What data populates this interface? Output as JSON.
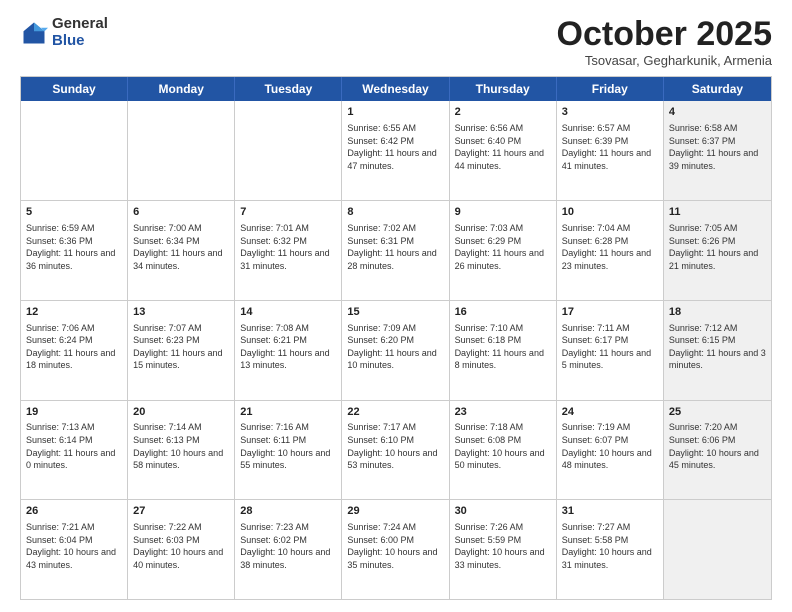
{
  "logo": {
    "general": "General",
    "blue": "Blue"
  },
  "title": "October 2025",
  "location": "Tsovasar, Gegharkunik, Armenia",
  "days_of_week": [
    "Sunday",
    "Monday",
    "Tuesday",
    "Wednesday",
    "Thursday",
    "Friday",
    "Saturday"
  ],
  "weeks": [
    [
      {
        "day": "",
        "sunrise": "",
        "sunset": "",
        "daylight": "",
        "shaded": false
      },
      {
        "day": "",
        "sunrise": "",
        "sunset": "",
        "daylight": "",
        "shaded": false
      },
      {
        "day": "",
        "sunrise": "",
        "sunset": "",
        "daylight": "",
        "shaded": false
      },
      {
        "day": "1",
        "sunrise": "Sunrise: 6:55 AM",
        "sunset": "Sunset: 6:42 PM",
        "daylight": "Daylight: 11 hours and 47 minutes.",
        "shaded": false
      },
      {
        "day": "2",
        "sunrise": "Sunrise: 6:56 AM",
        "sunset": "Sunset: 6:40 PM",
        "daylight": "Daylight: 11 hours and 44 minutes.",
        "shaded": false
      },
      {
        "day": "3",
        "sunrise": "Sunrise: 6:57 AM",
        "sunset": "Sunset: 6:39 PM",
        "daylight": "Daylight: 11 hours and 41 minutes.",
        "shaded": false
      },
      {
        "day": "4",
        "sunrise": "Sunrise: 6:58 AM",
        "sunset": "Sunset: 6:37 PM",
        "daylight": "Daylight: 11 hours and 39 minutes.",
        "shaded": true
      }
    ],
    [
      {
        "day": "5",
        "sunrise": "Sunrise: 6:59 AM",
        "sunset": "Sunset: 6:36 PM",
        "daylight": "Daylight: 11 hours and 36 minutes.",
        "shaded": false
      },
      {
        "day": "6",
        "sunrise": "Sunrise: 7:00 AM",
        "sunset": "Sunset: 6:34 PM",
        "daylight": "Daylight: 11 hours and 34 minutes.",
        "shaded": false
      },
      {
        "day": "7",
        "sunrise": "Sunrise: 7:01 AM",
        "sunset": "Sunset: 6:32 PM",
        "daylight": "Daylight: 11 hours and 31 minutes.",
        "shaded": false
      },
      {
        "day": "8",
        "sunrise": "Sunrise: 7:02 AM",
        "sunset": "Sunset: 6:31 PM",
        "daylight": "Daylight: 11 hours and 28 minutes.",
        "shaded": false
      },
      {
        "day": "9",
        "sunrise": "Sunrise: 7:03 AM",
        "sunset": "Sunset: 6:29 PM",
        "daylight": "Daylight: 11 hours and 26 minutes.",
        "shaded": false
      },
      {
        "day": "10",
        "sunrise": "Sunrise: 7:04 AM",
        "sunset": "Sunset: 6:28 PM",
        "daylight": "Daylight: 11 hours and 23 minutes.",
        "shaded": false
      },
      {
        "day": "11",
        "sunrise": "Sunrise: 7:05 AM",
        "sunset": "Sunset: 6:26 PM",
        "daylight": "Daylight: 11 hours and 21 minutes.",
        "shaded": true
      }
    ],
    [
      {
        "day": "12",
        "sunrise": "Sunrise: 7:06 AM",
        "sunset": "Sunset: 6:24 PM",
        "daylight": "Daylight: 11 hours and 18 minutes.",
        "shaded": false
      },
      {
        "day": "13",
        "sunrise": "Sunrise: 7:07 AM",
        "sunset": "Sunset: 6:23 PM",
        "daylight": "Daylight: 11 hours and 15 minutes.",
        "shaded": false
      },
      {
        "day": "14",
        "sunrise": "Sunrise: 7:08 AM",
        "sunset": "Sunset: 6:21 PM",
        "daylight": "Daylight: 11 hours and 13 minutes.",
        "shaded": false
      },
      {
        "day": "15",
        "sunrise": "Sunrise: 7:09 AM",
        "sunset": "Sunset: 6:20 PM",
        "daylight": "Daylight: 11 hours and 10 minutes.",
        "shaded": false
      },
      {
        "day": "16",
        "sunrise": "Sunrise: 7:10 AM",
        "sunset": "Sunset: 6:18 PM",
        "daylight": "Daylight: 11 hours and 8 minutes.",
        "shaded": false
      },
      {
        "day": "17",
        "sunrise": "Sunrise: 7:11 AM",
        "sunset": "Sunset: 6:17 PM",
        "daylight": "Daylight: 11 hours and 5 minutes.",
        "shaded": false
      },
      {
        "day": "18",
        "sunrise": "Sunrise: 7:12 AM",
        "sunset": "Sunset: 6:15 PM",
        "daylight": "Daylight: 11 hours and 3 minutes.",
        "shaded": true
      }
    ],
    [
      {
        "day": "19",
        "sunrise": "Sunrise: 7:13 AM",
        "sunset": "Sunset: 6:14 PM",
        "daylight": "Daylight: 11 hours and 0 minutes.",
        "shaded": false
      },
      {
        "day": "20",
        "sunrise": "Sunrise: 7:14 AM",
        "sunset": "Sunset: 6:13 PM",
        "daylight": "Daylight: 10 hours and 58 minutes.",
        "shaded": false
      },
      {
        "day": "21",
        "sunrise": "Sunrise: 7:16 AM",
        "sunset": "Sunset: 6:11 PM",
        "daylight": "Daylight: 10 hours and 55 minutes.",
        "shaded": false
      },
      {
        "day": "22",
        "sunrise": "Sunrise: 7:17 AM",
        "sunset": "Sunset: 6:10 PM",
        "daylight": "Daylight: 10 hours and 53 minutes.",
        "shaded": false
      },
      {
        "day": "23",
        "sunrise": "Sunrise: 7:18 AM",
        "sunset": "Sunset: 6:08 PM",
        "daylight": "Daylight: 10 hours and 50 minutes.",
        "shaded": false
      },
      {
        "day": "24",
        "sunrise": "Sunrise: 7:19 AM",
        "sunset": "Sunset: 6:07 PM",
        "daylight": "Daylight: 10 hours and 48 minutes.",
        "shaded": false
      },
      {
        "day": "25",
        "sunrise": "Sunrise: 7:20 AM",
        "sunset": "Sunset: 6:06 PM",
        "daylight": "Daylight: 10 hours and 45 minutes.",
        "shaded": true
      }
    ],
    [
      {
        "day": "26",
        "sunrise": "Sunrise: 7:21 AM",
        "sunset": "Sunset: 6:04 PM",
        "daylight": "Daylight: 10 hours and 43 minutes.",
        "shaded": false
      },
      {
        "day": "27",
        "sunrise": "Sunrise: 7:22 AM",
        "sunset": "Sunset: 6:03 PM",
        "daylight": "Daylight: 10 hours and 40 minutes.",
        "shaded": false
      },
      {
        "day": "28",
        "sunrise": "Sunrise: 7:23 AM",
        "sunset": "Sunset: 6:02 PM",
        "daylight": "Daylight: 10 hours and 38 minutes.",
        "shaded": false
      },
      {
        "day": "29",
        "sunrise": "Sunrise: 7:24 AM",
        "sunset": "Sunset: 6:00 PM",
        "daylight": "Daylight: 10 hours and 35 minutes.",
        "shaded": false
      },
      {
        "day": "30",
        "sunrise": "Sunrise: 7:26 AM",
        "sunset": "Sunset: 5:59 PM",
        "daylight": "Daylight: 10 hours and 33 minutes.",
        "shaded": false
      },
      {
        "day": "31",
        "sunrise": "Sunrise: 7:27 AM",
        "sunset": "Sunset: 5:58 PM",
        "daylight": "Daylight: 10 hours and 31 minutes.",
        "shaded": false
      },
      {
        "day": "",
        "sunrise": "",
        "sunset": "",
        "daylight": "",
        "shaded": true
      }
    ]
  ]
}
